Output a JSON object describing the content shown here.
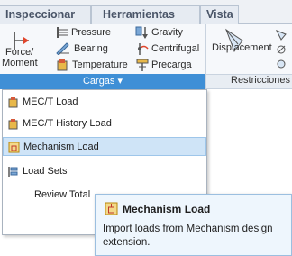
{
  "tabs": [
    "Inspeccionar",
    "Herramientas",
    "Vista"
  ],
  "ribbon": {
    "force_moment_line1": "Force/",
    "force_moment_line2": "Moment",
    "pressure": "Pressure",
    "bearing": "Bearing",
    "temperature": "Temperature",
    "gravity": "Gravity",
    "centrifugal": "Centrifugal",
    "precarga": "Precarga",
    "displacement": "Displacement"
  },
  "groups": {
    "cargas": "Cargas ▾",
    "restricciones": "Restricciones"
  },
  "menu": {
    "items": [
      "MEC/T Load",
      "MEC/T History Load",
      "Mechanism Load",
      "Load Sets",
      "Review Total"
    ]
  },
  "tooltip": {
    "title": "Mechanism Load",
    "description": "Import loads from Mechanism design extension."
  },
  "colors": {
    "accent": "#3f8fd6",
    "selected_bg": "#cfe4f7",
    "tooltip_bg": "#eef6fd"
  }
}
